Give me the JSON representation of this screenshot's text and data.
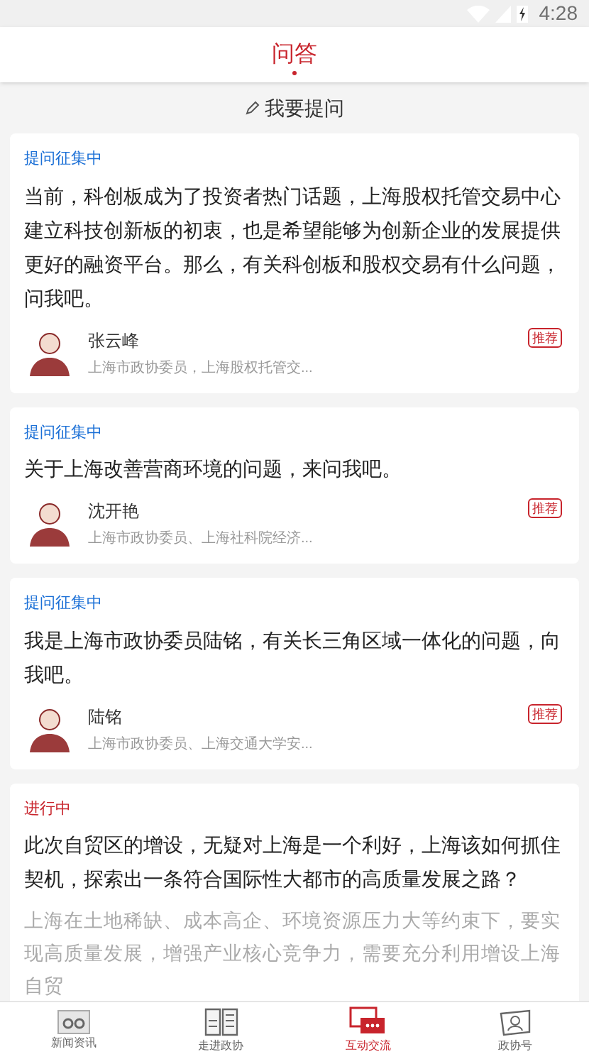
{
  "status_bar": {
    "time": "4:28"
  },
  "header": {
    "title": "问答",
    "selected": true
  },
  "ask_button": {
    "label": "我要提问"
  },
  "cards": [
    {
      "status": "提问征集中",
      "color": "#1a6fd6",
      "question": "当前，科创板成为了投资者热门话题，上海股权托管交易中心建立科技创新板的初衷，也是希望能够为创新企业的发展提供更好的融资平台。那么，有关科创板和股权交易有什么问题，问我吧。",
      "name": "张云峰",
      "title": "上海市政协委员，上海股权托管交...",
      "badge": "推荐"
    },
    {
      "status": "提问征集中",
      "color": "#1a6fd6",
      "question": "关于上海改善营商环境的问题，来问我吧。",
      "name": "沈开艳",
      "title": "上海市政协委员、上海社科院经济...",
      "badge": "推荐"
    },
    {
      "status": "提问征集中",
      "color": "#1a6fd6",
      "question": "我是上海市政协委员陆铭，有关长三角区域一体化的问题，向我吧。",
      "name": "陆铭",
      "title": "上海市政协委员、上海交通大学安...",
      "badge": "推荐"
    },
    {
      "status": "进行中",
      "color": "#c8242c",
      "question": "此次自贸区的增设，无疑对上海是一个利好，上海该如何抓住契机，探索出一条符合国际性大都市的高质量发展之路？",
      "excerpt": "上海在土地稀缺、成本高企、环境资源压力大等约束下，要实现高质量发展，增强产业核心竞争力，需要充分利用增设上海自贸"
    }
  ],
  "nav": [
    {
      "label": "新闻资讯",
      "kind": "glasses",
      "selected": false
    },
    {
      "label": "走进政协",
      "kind": "book",
      "selected": false
    },
    {
      "label": "互动交流",
      "kind": "chat",
      "selected": true
    },
    {
      "label": "政协号",
      "kind": "person",
      "selected": false
    }
  ]
}
